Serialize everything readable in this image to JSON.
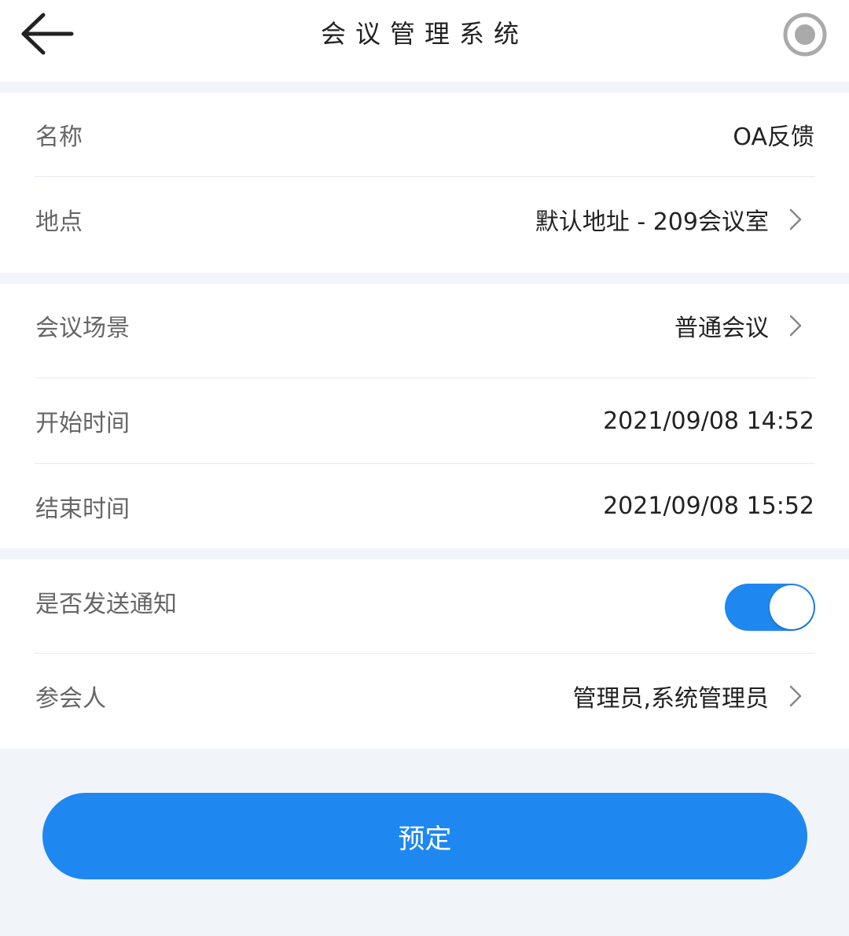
{
  "header": {
    "title": "会议管理系统",
    "back_icon": "arrow-left-icon",
    "record_icon": "record-circle-icon"
  },
  "form": {
    "name": {
      "label": "名称",
      "value": "OA反馈"
    },
    "location": {
      "label": "地点",
      "value": "默认地址 - 209会议室"
    },
    "scene": {
      "label": "会议场景",
      "value": "普通会议"
    },
    "start_time": {
      "label": "开始时间",
      "value": "2021/09/08 14:52"
    },
    "end_time": {
      "label": "结束时间",
      "value": "2021/09/08 15:52"
    },
    "notify": {
      "label": "是否发送通知",
      "enabled": true
    },
    "participants": {
      "label": "参会人",
      "value": "管理员,系统管理员"
    }
  },
  "submit_button": {
    "label": "预定"
  },
  "colors": {
    "accent": "#1f87f0",
    "background": "#f1f4f9",
    "label": "#666666",
    "value": "#222222"
  }
}
